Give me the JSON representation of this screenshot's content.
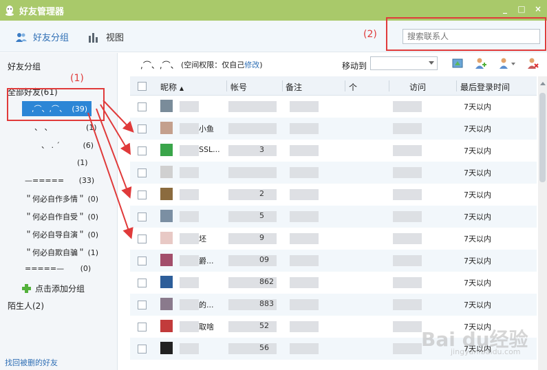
{
  "window": {
    "title": "好友管理器",
    "controls": {
      "minimize": "_",
      "maximize": "□",
      "close": "×"
    }
  },
  "toolbar": {
    "friends_groups": "好友分组",
    "view": "视图"
  },
  "annotations": {
    "one": "(1)",
    "two": "(2)"
  },
  "search": {
    "placeholder": "搜索联系人"
  },
  "sidebar": {
    "title": "好友分组",
    "all_friends": "全部好友(61)",
    "selected_group": {
      "name": ",⌒、,⌒、",
      "count": "(39)"
    },
    "groups": [
      {
        "name": "、 、",
        "count": "(1)"
      },
      {
        "name": "、 . ´",
        "count": "(6)"
      },
      {
        "name": "",
        "count": "(1)"
      },
      {
        "name": "—=====",
        "count": "(33)"
      },
      {
        "name": "＂何必自作多情＂",
        "count": "(0)"
      },
      {
        "name": "＂何必自作自受＂",
        "count": "(0)"
      },
      {
        "name": "＂何必自导自演＂",
        "count": "(0)"
      },
      {
        "name": "＂何必自欺自骗＂",
        "count": "(1)"
      },
      {
        "name": "=====—",
        "count": "(0)"
      }
    ],
    "add_group": "点击添加分组",
    "strangers": "陌生人(2)",
    "recover": "找回被删的好友"
  },
  "main": {
    "group_label": ",⌒、,⌒、",
    "permission_prefix": "(空间权限：仅自己",
    "permission_link": "修改",
    "permission_suffix": ")",
    "move_to": "移动到"
  },
  "table": {
    "columns": [
      "昵称",
      "帐号",
      "备注",
      "个",
      "访问",
      "最后登录时间"
    ],
    "rows": [
      {
        "nick": "",
        "account": "",
        "last_login": "7天以内",
        "color": "#7a8c9a"
      },
      {
        "nick": "小鱼",
        "account": "",
        "last_login": "7天以内",
        "color": "#c4a08d"
      },
      {
        "nick": "SSL...",
        "account": "3",
        "last_login": "7天以内",
        "color": "#3aa54a"
      },
      {
        "nick": "",
        "account": "",
        "last_login": "7天以内",
        "color": "#d0d0d0"
      },
      {
        "nick": "",
        "account": "2",
        "last_login": "7天以内",
        "color": "#8b6b3e"
      },
      {
        "nick": "",
        "account": "5",
        "last_login": "7天以内",
        "color": "#7b8fa3"
      },
      {
        "nick": "坯",
        "account": "9",
        "last_login": "7天以内",
        "color": "#e8c9c5"
      },
      {
        "nick": "爵...",
        "account": "09",
        "last_login": "7天以内",
        "color": "#a34e6b"
      },
      {
        "nick": "",
        "account": "862",
        "last_login": "7天以内",
        "color": "#2d5e9a"
      },
      {
        "nick": "的...",
        "account": "883",
        "last_login": "7天以内",
        "color": "#8a7a8c"
      },
      {
        "nick": "取啥",
        "account": "52",
        "last_login": "7天以内",
        "color": "#c23b3b"
      },
      {
        "nick": "",
        "account": "56",
        "last_login": "7天以内",
        "color": "#222222"
      }
    ]
  },
  "watermark": {
    "main": "Bai du经验",
    "sub": "jingyan.baidu.com"
  },
  "colors": {
    "accent": "#2c86d6",
    "titlebar": "#a9c96a",
    "annotation": "#e03a3a",
    "link": "#2f6fb5"
  }
}
